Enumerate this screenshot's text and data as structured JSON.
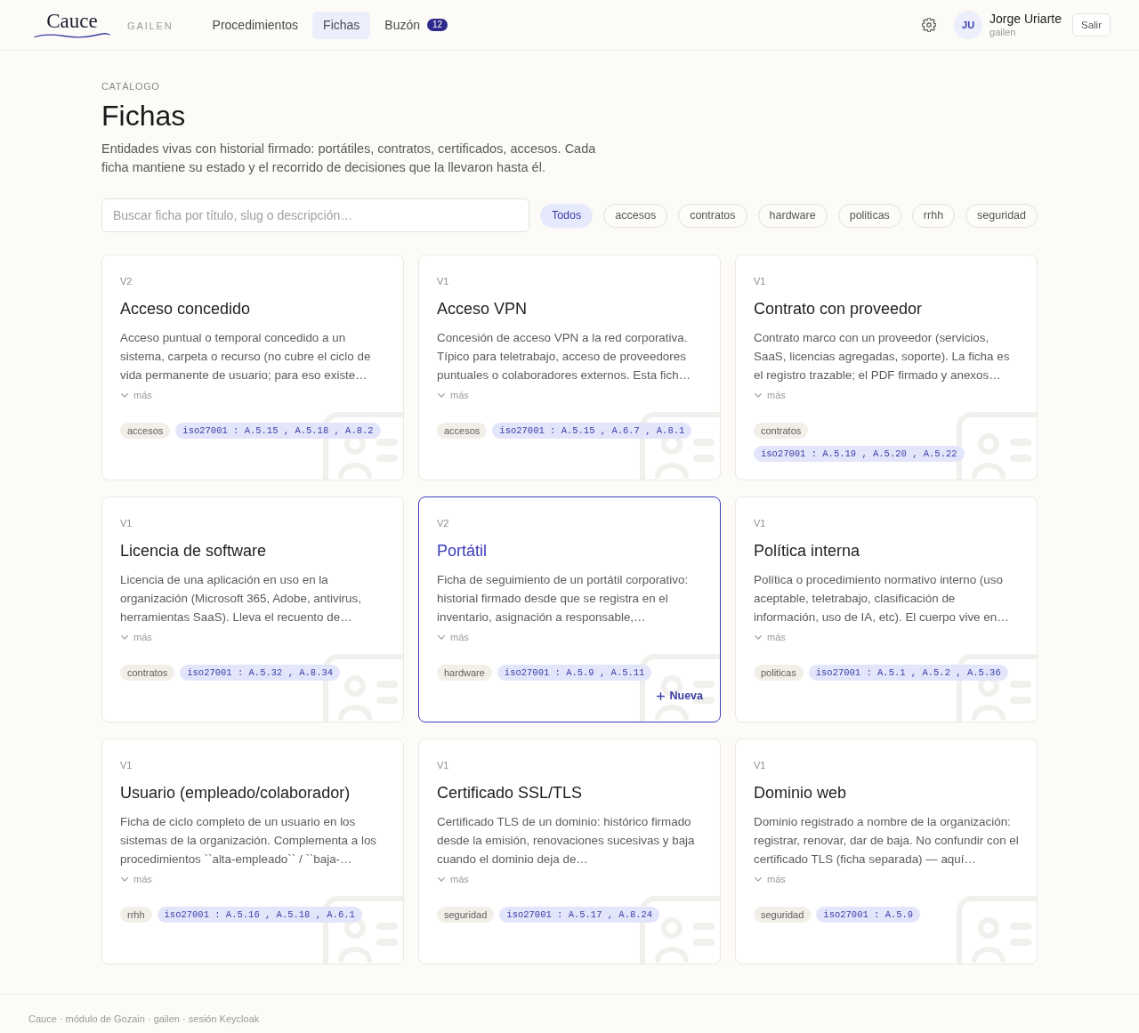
{
  "header": {
    "logo": "Cauce",
    "org": "GAILEN",
    "nav": [
      {
        "label": "Procedimientos",
        "selected": false
      },
      {
        "label": "Fichas",
        "selected": true
      },
      {
        "label": "Buzón",
        "selected": false,
        "badge": "12"
      }
    ],
    "user": {
      "initials": "JU",
      "name": "Jorge Uriarte",
      "org": "gailen"
    },
    "logout": "Salir"
  },
  "intro": {
    "eyebrow": "CATÁLOGO",
    "title": "Fichas",
    "description": "Entidades vivas con historial firmado: portátiles, contratos, certificados, accesos. Cada ficha mantiene su estado y el recorrido de decisiones que la llevaron hasta él."
  },
  "search": {
    "placeholder": "Buscar ficha por título, slug o descripción…"
  },
  "filters": [
    {
      "label": "Todos",
      "selected": true
    },
    {
      "label": "accesos",
      "selected": false
    },
    {
      "label": "contratos",
      "selected": false
    },
    {
      "label": "hardware",
      "selected": false
    },
    {
      "label": "politicas",
      "selected": false
    },
    {
      "label": "rrhh",
      "selected": false
    },
    {
      "label": "seguridad",
      "selected": false
    }
  ],
  "cards": [
    {
      "version": "V2",
      "title": "Acceso concedido",
      "description": "Acceso puntual o temporal concedido a un sistema, carpeta o recurso (no cubre el ciclo de vida permanente de usuario; para eso existe…",
      "more": "más",
      "selected": false,
      "tags": [
        {
          "kind": "category",
          "label": "accesos"
        },
        {
          "kind": "control",
          "label": "iso27001 : A.5.15 , A.5.18 , A.8.2"
        }
      ]
    },
    {
      "version": "V1",
      "title": "Acceso VPN",
      "description": "Concesión de acceso VPN a la red corporativa. Típico para teletrabajo, acceso de proveedores puntuales o colaboradores externos. Esta fich…",
      "more": "más",
      "selected": false,
      "tags": [
        {
          "kind": "category",
          "label": "accesos"
        },
        {
          "kind": "control",
          "label": "iso27001 : A.5.15 , A.6.7 , A.8.1"
        }
      ]
    },
    {
      "version": "V1",
      "title": "Contrato con proveedor",
      "description": "Contrato marco con un proveedor (servicios, SaaS, licencias agregadas, soporte). La ficha es el registro trazable; el PDF firmado y anexos…",
      "more": "más",
      "selected": false,
      "tags": [
        {
          "kind": "category",
          "label": "contratos"
        },
        {
          "kind": "control",
          "label": "iso27001 : A.5.19 , A.5.20 , A.5.22"
        }
      ]
    },
    {
      "version": "V1",
      "title": "Licencia de software",
      "description": "Licencia de una aplicación en uso en la organización (Microsoft 365, Adobe, antivirus, herramientas SaaS). Lleva el recuento de…",
      "more": "más",
      "selected": false,
      "tags": [
        {
          "kind": "category",
          "label": "contratos"
        },
        {
          "kind": "control",
          "label": "iso27001 : A.5.32 , A.8.34"
        }
      ]
    },
    {
      "version": "V2",
      "title": "Portátil",
      "description": "Ficha de seguimiento de un portátil corporativo: historial firmado desde que se registra en el inventario, asignación a responsable,…",
      "more": "más",
      "selected": true,
      "action": "Nueva",
      "tags": [
        {
          "kind": "category",
          "label": "hardware"
        },
        {
          "kind": "control",
          "label": "iso27001 : A.5.9 , A.5.11"
        }
      ]
    },
    {
      "version": "V1",
      "title": "Política interna",
      "description": "Política o procedimiento normativo interno (uso aceptable, teletrabajo, clasificación de información, uso de IA, etc). El cuerpo vive en…",
      "more": "más",
      "selected": false,
      "tags": [
        {
          "kind": "category",
          "label": "politicas"
        },
        {
          "kind": "control",
          "label": "iso27001 : A.5.1 , A.5.2 , A.5.36"
        }
      ]
    },
    {
      "version": "V1",
      "title": "Usuario (empleado/colaborador)",
      "description": "Ficha de ciclo completo de un usuario en los sistemas de la organización. Complementa a los procedimientos ``alta-empleado`` / ``baja-…",
      "more": "más",
      "selected": false,
      "tags": [
        {
          "kind": "category",
          "label": "rrhh"
        },
        {
          "kind": "control",
          "label": "iso27001 : A.5.16 , A.5.18 , A.6.1"
        }
      ]
    },
    {
      "version": "V1",
      "title": "Certificado SSL/TLS",
      "description": "Certificado TLS de un dominio: histórico firmado desde la emisión, renovaciones sucesivas y baja cuando el dominio deja de…",
      "more": "más",
      "selected": false,
      "tags": [
        {
          "kind": "category",
          "label": "seguridad"
        },
        {
          "kind": "control",
          "label": "iso27001 : A.5.17 , A.8.24"
        }
      ]
    },
    {
      "version": "V1",
      "title": "Dominio web",
      "description": "Dominio registrado a nombre de la organización: registrar, renovar, dar de baja. No confundir con el certificado TLS (ficha separada) — aquí…",
      "more": "más",
      "selected": false,
      "tags": [
        {
          "kind": "category",
          "label": "seguridad"
        },
        {
          "kind": "control",
          "label": "iso27001 : A.5.9"
        }
      ]
    }
  ],
  "footer": "Cauce · módulo de Gozain · gailen · sesión Keycloak"
}
